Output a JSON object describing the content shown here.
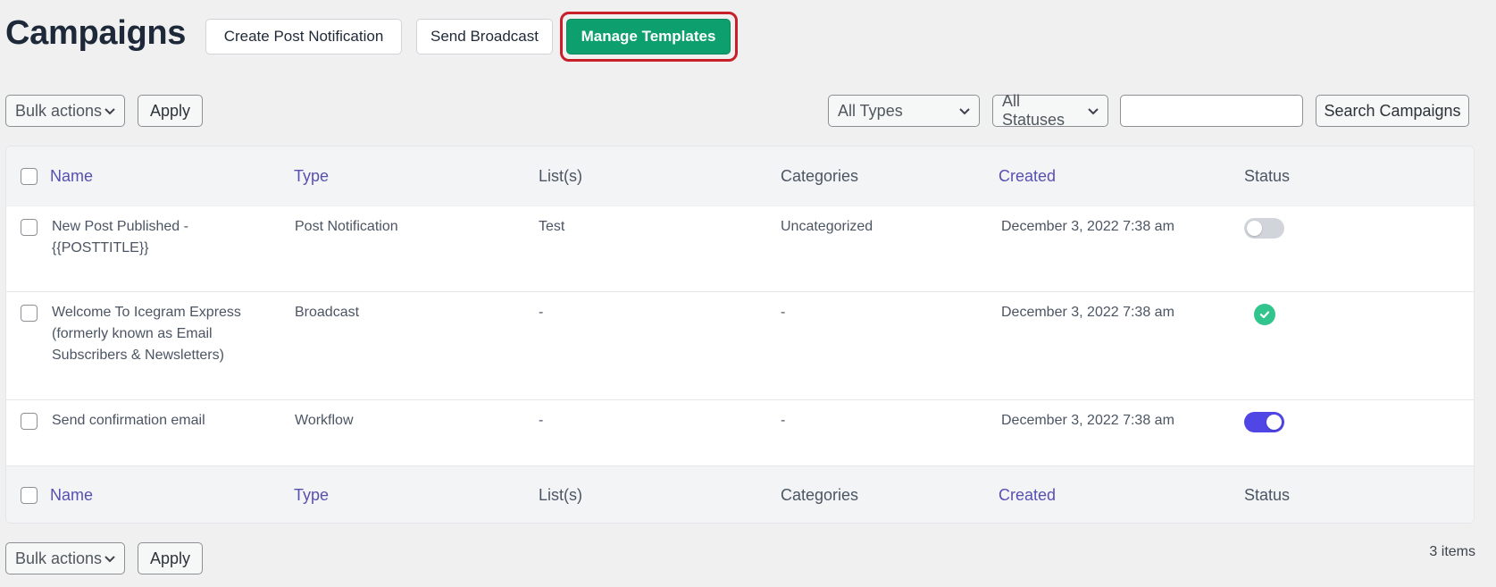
{
  "header": {
    "title": "Campaigns",
    "buttons": {
      "create_post_notification": "Create Post Notification",
      "send_broadcast": "Send Broadcast",
      "manage_templates": "Manage Templates"
    }
  },
  "toolbar_top": {
    "bulk_actions": "Bulk actions",
    "apply": "Apply",
    "type_filter": "All Types",
    "status_filter": "All Statuses",
    "search_value": "",
    "search_button": "Search Campaigns"
  },
  "table": {
    "columns": {
      "name": "Name",
      "type": "Type",
      "lists": "List(s)",
      "categories": "Categories",
      "created": "Created",
      "status": "Status"
    },
    "rows": [
      {
        "name_line1": "New Post Published -",
        "name_line2": "{{POSTTITLE}}",
        "name_line3": "",
        "type": "Post Notification",
        "lists": "Test",
        "categories": "Uncategorized",
        "created": "December 3, 2022 7:38 am",
        "status": "toggle-off"
      },
      {
        "name_line1": "Welcome To Icegram Express",
        "name_line2": "(formerly known as Email",
        "name_line3": "Subscribers & Newsletters)",
        "type": "Broadcast",
        "lists": "-",
        "categories": "-",
        "created": "December 3, 2022 7:38 am",
        "status": "sent-check"
      },
      {
        "name_line1": "Send confirmation email",
        "name_line2": "",
        "name_line3": "",
        "type": "Workflow",
        "lists": "-",
        "categories": "-",
        "created": "December 3, 2022 7:38 am",
        "status": "toggle-on"
      }
    ]
  },
  "toolbar_bottom": {
    "bulk_actions": "Bulk actions",
    "apply": "Apply",
    "items_count": "3 items"
  },
  "colors": {
    "primary_green": "#0e9f6e",
    "highlight_red": "#c8202a",
    "link_purple": "#5850b0",
    "toggle_on": "#4f46e5",
    "status_check": "#31c48d"
  }
}
